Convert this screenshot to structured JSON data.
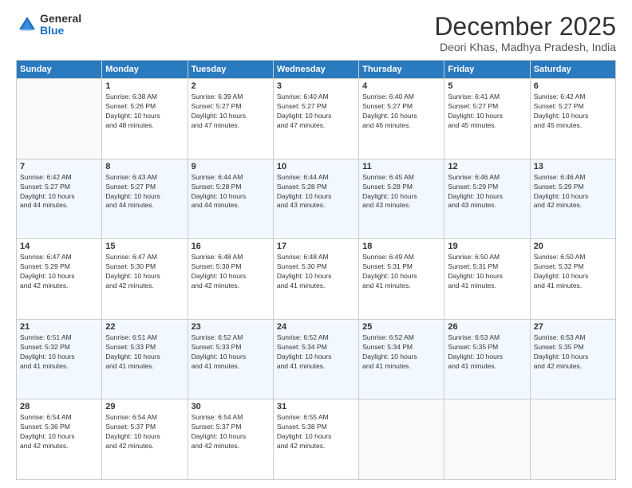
{
  "logo": {
    "general": "General",
    "blue": "Blue"
  },
  "title": "December 2025",
  "subtitle": "Deori Khas, Madhya Pradesh, India",
  "weekdays": [
    "Sunday",
    "Monday",
    "Tuesday",
    "Wednesday",
    "Thursday",
    "Friday",
    "Saturday"
  ],
  "weeks": [
    [
      {
        "day": "",
        "info": ""
      },
      {
        "day": "1",
        "info": "Sunrise: 6:38 AM\nSunset: 5:26 PM\nDaylight: 10 hours\nand 48 minutes."
      },
      {
        "day": "2",
        "info": "Sunrise: 6:39 AM\nSunset: 5:27 PM\nDaylight: 10 hours\nand 47 minutes."
      },
      {
        "day": "3",
        "info": "Sunrise: 6:40 AM\nSunset: 5:27 PM\nDaylight: 10 hours\nand 47 minutes."
      },
      {
        "day": "4",
        "info": "Sunrise: 6:40 AM\nSunset: 5:27 PM\nDaylight: 10 hours\nand 46 minutes."
      },
      {
        "day": "5",
        "info": "Sunrise: 6:41 AM\nSunset: 5:27 PM\nDaylight: 10 hours\nand 45 minutes."
      },
      {
        "day": "6",
        "info": "Sunrise: 6:42 AM\nSunset: 5:27 PM\nDaylight: 10 hours\nand 45 minutes."
      }
    ],
    [
      {
        "day": "7",
        "info": "Sunrise: 6:42 AM\nSunset: 5:27 PM\nDaylight: 10 hours\nand 44 minutes."
      },
      {
        "day": "8",
        "info": "Sunrise: 6:43 AM\nSunset: 5:27 PM\nDaylight: 10 hours\nand 44 minutes."
      },
      {
        "day": "9",
        "info": "Sunrise: 6:44 AM\nSunset: 5:28 PM\nDaylight: 10 hours\nand 44 minutes."
      },
      {
        "day": "10",
        "info": "Sunrise: 6:44 AM\nSunset: 5:28 PM\nDaylight: 10 hours\nand 43 minutes."
      },
      {
        "day": "11",
        "info": "Sunrise: 6:45 AM\nSunset: 5:28 PM\nDaylight: 10 hours\nand 43 minutes."
      },
      {
        "day": "12",
        "info": "Sunrise: 6:46 AM\nSunset: 5:29 PM\nDaylight: 10 hours\nand 43 minutes."
      },
      {
        "day": "13",
        "info": "Sunrise: 6:46 AM\nSunset: 5:29 PM\nDaylight: 10 hours\nand 42 minutes."
      }
    ],
    [
      {
        "day": "14",
        "info": "Sunrise: 6:47 AM\nSunset: 5:29 PM\nDaylight: 10 hours\nand 42 minutes."
      },
      {
        "day": "15",
        "info": "Sunrise: 6:47 AM\nSunset: 5:30 PM\nDaylight: 10 hours\nand 42 minutes."
      },
      {
        "day": "16",
        "info": "Sunrise: 6:48 AM\nSunset: 5:30 PM\nDaylight: 10 hours\nand 42 minutes."
      },
      {
        "day": "17",
        "info": "Sunrise: 6:48 AM\nSunset: 5:30 PM\nDaylight: 10 hours\nand 41 minutes."
      },
      {
        "day": "18",
        "info": "Sunrise: 6:49 AM\nSunset: 5:31 PM\nDaylight: 10 hours\nand 41 minutes."
      },
      {
        "day": "19",
        "info": "Sunrise: 6:50 AM\nSunset: 5:31 PM\nDaylight: 10 hours\nand 41 minutes."
      },
      {
        "day": "20",
        "info": "Sunrise: 6:50 AM\nSunset: 5:32 PM\nDaylight: 10 hours\nand 41 minutes."
      }
    ],
    [
      {
        "day": "21",
        "info": "Sunrise: 6:51 AM\nSunset: 5:32 PM\nDaylight: 10 hours\nand 41 minutes."
      },
      {
        "day": "22",
        "info": "Sunrise: 6:51 AM\nSunset: 5:33 PM\nDaylight: 10 hours\nand 41 minutes."
      },
      {
        "day": "23",
        "info": "Sunrise: 6:52 AM\nSunset: 5:33 PM\nDaylight: 10 hours\nand 41 minutes."
      },
      {
        "day": "24",
        "info": "Sunrise: 6:52 AM\nSunset: 5:34 PM\nDaylight: 10 hours\nand 41 minutes."
      },
      {
        "day": "25",
        "info": "Sunrise: 6:52 AM\nSunset: 5:34 PM\nDaylight: 10 hours\nand 41 minutes."
      },
      {
        "day": "26",
        "info": "Sunrise: 6:53 AM\nSunset: 5:35 PM\nDaylight: 10 hours\nand 41 minutes."
      },
      {
        "day": "27",
        "info": "Sunrise: 6:53 AM\nSunset: 5:35 PM\nDaylight: 10 hours\nand 42 minutes."
      }
    ],
    [
      {
        "day": "28",
        "info": "Sunrise: 6:54 AM\nSunset: 5:36 PM\nDaylight: 10 hours\nand 42 minutes."
      },
      {
        "day": "29",
        "info": "Sunrise: 6:54 AM\nSunset: 5:37 PM\nDaylight: 10 hours\nand 42 minutes."
      },
      {
        "day": "30",
        "info": "Sunrise: 6:54 AM\nSunset: 5:37 PM\nDaylight: 10 hours\nand 42 minutes."
      },
      {
        "day": "31",
        "info": "Sunrise: 6:55 AM\nSunset: 5:38 PM\nDaylight: 10 hours\nand 42 minutes."
      },
      {
        "day": "",
        "info": ""
      },
      {
        "day": "",
        "info": ""
      },
      {
        "day": "",
        "info": ""
      }
    ]
  ]
}
